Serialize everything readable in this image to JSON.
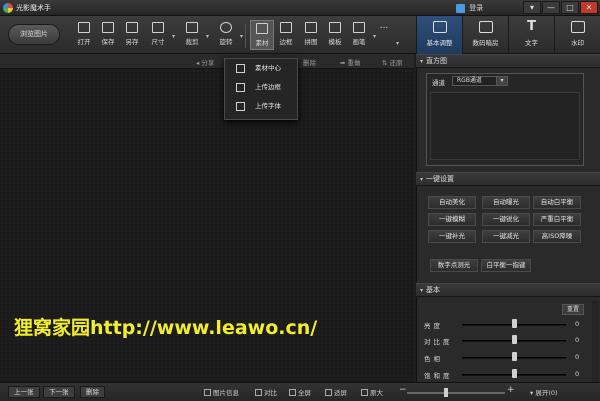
{
  "window": {
    "title": "光影魔术手",
    "login_label": "登录",
    "controls": [
      "▾",
      "—",
      "□",
      "✕"
    ]
  },
  "toolbar": {
    "browse_label": "浏览图片",
    "tools": [
      {
        "label": "打开",
        "icon": "open-icon"
      },
      {
        "label": "保存",
        "icon": "save-icon"
      },
      {
        "label": "另存",
        "icon": "save-as-icon"
      },
      {
        "label": "尺寸",
        "icon": "resize-icon"
      },
      {
        "label": "裁剪",
        "icon": "crop-icon"
      },
      {
        "label": "旋转",
        "icon": "rotate-icon"
      },
      {
        "label": "素材",
        "icon": "material-icon"
      },
      {
        "label": "边框",
        "icon": "border-icon"
      },
      {
        "label": "拼图",
        "icon": "collage-icon"
      },
      {
        "label": "模板",
        "icon": "template-icon"
      },
      {
        "label": "画笔",
        "icon": "brush-icon"
      },
      {
        "label": "...",
        "icon": "more-icon"
      }
    ],
    "right_tabs": [
      {
        "label": "基本调整",
        "icon": "adjust-icon"
      },
      {
        "label": "数码暗房",
        "icon": "darkroom-icon"
      },
      {
        "label": "文字",
        "icon": "text-icon"
      },
      {
        "label": "水印",
        "icon": "watermark-icon"
      }
    ]
  },
  "subbar": {
    "share": "分享",
    "delete": "删除",
    "redo": "重做",
    "restore": "还原"
  },
  "material_menu": {
    "items": [
      "素材中心",
      "上传边框",
      "上传字体"
    ]
  },
  "histogram": {
    "title": "直方图",
    "channel_label": "通道",
    "channel_value": "RGB通道"
  },
  "one_click": {
    "title": "一键设置",
    "buttons": [
      [
        "自动美化",
        "自动曝光",
        "自动白平衡"
      ],
      [
        "一键模糊",
        "一键锐化",
        "严重白平衡"
      ],
      [
        "一键补光",
        "一键减光",
        "高ISO降噪"
      ]
    ],
    "extra_buttons": [
      "数字点测光",
      "白平衡一指键"
    ]
  },
  "basic": {
    "title": "基本",
    "reset_label": "重置",
    "sliders": [
      {
        "name": "亮度",
        "value": "0",
        "level": 0.5
      },
      {
        "name": "对比度",
        "value": "0",
        "level": 0.5
      },
      {
        "name": "色相",
        "value": "0",
        "level": 0.5
      },
      {
        "name": "饱和度",
        "value": "0",
        "level": 0.5
      }
    ]
  },
  "bottombar": {
    "prev": "上一张",
    "next": "下一张",
    "delete": "删除",
    "info": "图片信息",
    "compare": "对比",
    "fullscreen": "全屏",
    "fit": "适屏",
    "original": "原大",
    "zoom_minus": "−",
    "zoom_plus": "+",
    "expand": "展开(0)",
    "zoom_level": 0.4
  },
  "watermark_text": "狸窝家园http://www.leawo.cn/"
}
